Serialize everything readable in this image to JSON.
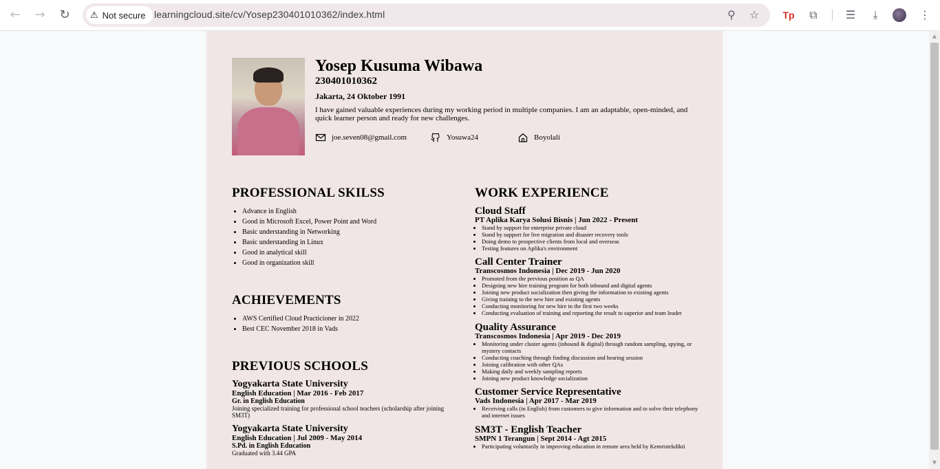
{
  "browser": {
    "security_label": "Not secure",
    "url": "learningcloud.site/cv/Yosep230401010362/index.html"
  },
  "cv": {
    "name": "Yosep Kusuma Wibawa",
    "nim": "230401010362",
    "birth": "Jakarta, 24 Oktober 1991",
    "summary": "I have gained valuable experiences during my working period in multiple companies. I am an adaptable, open-minded, and quick learner person and ready for new challenges.",
    "email": "joe.seven08@gmail.com",
    "github": "Yosuwa24",
    "city": "Boyolali",
    "skills_title": "PROFESSIONAL SKILSS",
    "skills": [
      "Advance in English",
      "Good in Microsoft Excel, Power Point and Word",
      "Basic understanding in Networking",
      "Basic understanding in Linux",
      "Good in analytical skill",
      "Good in organization skill"
    ],
    "achievements_title": "ACHIEVEMENTS",
    "achievements": [
      "AWS Certified Cloud Practicioner in 2022",
      "Best CEC November 2018 in Vads"
    ],
    "schools_title": "PREVIOUS SCHOOLS",
    "schools": [
      {
        "name": "Yogyakarta State University",
        "program": "English Education | Mar 2016 - Feb 2017",
        "degree": "Gr. in English Education",
        "desc": "Joining specialized training for professional school teachers (scholarship after joining SM3T)"
      },
      {
        "name": "Yogyakarta State University",
        "program": "English Education | Jul 2009 - May 2014",
        "degree": "S.Pd. in English Education",
        "desc": "Graduated with 3.44 GPA"
      }
    ],
    "work_title": "WORK EXPERIENCE",
    "jobs": [
      {
        "title": "Cloud Staff",
        "org": "PT Aplika Karya Solusi Bisnis | Jun 2022 - Present",
        "points": [
          "Stand by support for enterprise private cloud",
          "Stand by support for live migration and disaster recovery tools",
          "Doing demo to prospective clients from local and overseas",
          "Testing features on Aplika's environment"
        ]
      },
      {
        "title": "Call Center Trainer",
        "org": "Transcosmos Indonesia | Dec 2019 - Jun 2020",
        "points": [
          "Promoted from the previous position as QA",
          "Designing new hire training program for both inbound and digital agents",
          "Joining new product socialization then giving the information to existing agents",
          "Giving training to the new hire and existing agents",
          "Conducting monitoring for new hire in the first two weeks",
          "Conducting evaluation of training and reporting the result to superior and team leader"
        ]
      },
      {
        "title": "Quality Assurance",
        "org": "Transcosmos Indonesia | Apr 2019 - Dec 2019",
        "points": [
          "Monitoring under cluster agents (inbound & digital) through random sampling, spying, or mystery contacts",
          "Conducting coaching through finding discussion and hearing session",
          "Joining calibration with other QAs",
          "Making daily and weekly sampling reports",
          "Joining new product knowledge socialization"
        ]
      },
      {
        "title": "Customer Service Representative",
        "org": "Vads Indonesia | Apr 2017 - Mar 2019",
        "points": [
          "Receiving calls (in English) from customers to give information and to solve their telephony and internet issues"
        ]
      },
      {
        "title": "SM3T - English Teacher",
        "org": "SMPN 1 Terangun | Sept 2014 - Agt 2015",
        "points": [
          "Participating voluntarily in improving education in remote area held by Kemristekdikti"
        ]
      }
    ]
  }
}
